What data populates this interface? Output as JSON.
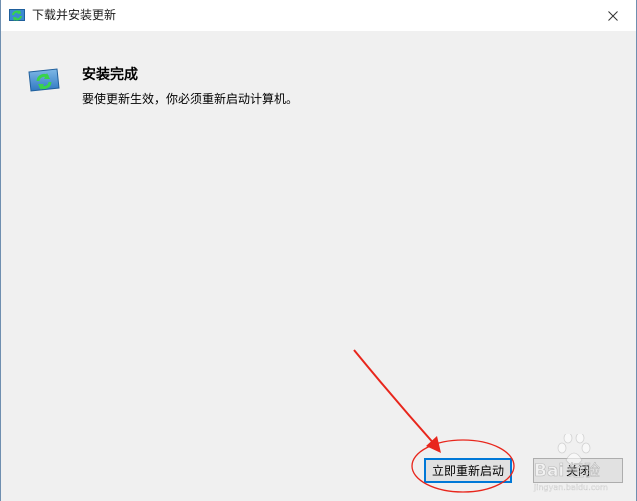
{
  "window": {
    "title": "下载并安装更新"
  },
  "status": {
    "heading": "安装完成",
    "message": "要使更新生效，你必须重新启动计算机。"
  },
  "buttons": {
    "restart_now": "立即重新启动",
    "close": "关闭"
  },
  "icons": {
    "title_icon": "windows-update-icon",
    "status_icon": "update-complete-icon",
    "close_icon": "close-icon"
  },
  "annotation": {
    "color": "#e8261c"
  },
  "watermark": {
    "text": "Bai经验",
    "sub": "jingyan.baidu.com"
  }
}
